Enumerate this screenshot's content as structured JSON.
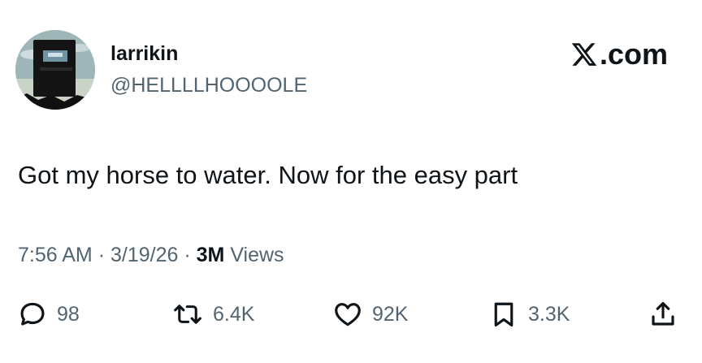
{
  "author": {
    "display_name": "larrikin",
    "handle": "@HELLLLHOOOOLE"
  },
  "brand": {
    "label": ".com",
    "icon": "x-logo-icon"
  },
  "tweet": {
    "text": "Got my horse to water. Now for the easy part"
  },
  "meta": {
    "time": "7:56 AM",
    "sep1": "·",
    "date": "3/19/26",
    "sep2": "·",
    "views_count": "3M",
    "views_label": "Views"
  },
  "actions": {
    "replies": {
      "icon": "reply-bubble-icon",
      "count": "98"
    },
    "reposts": {
      "icon": "repost-icon",
      "count": "6.4K"
    },
    "likes": {
      "icon": "heart-icon",
      "count": "92K"
    },
    "bookmarks": {
      "icon": "bookmark-icon",
      "count": "3.3K"
    },
    "share": {
      "icon": "share-icon"
    }
  },
  "colors": {
    "text_primary": "#0f1419",
    "text_secondary": "#536471",
    "background": "#ffffff"
  }
}
